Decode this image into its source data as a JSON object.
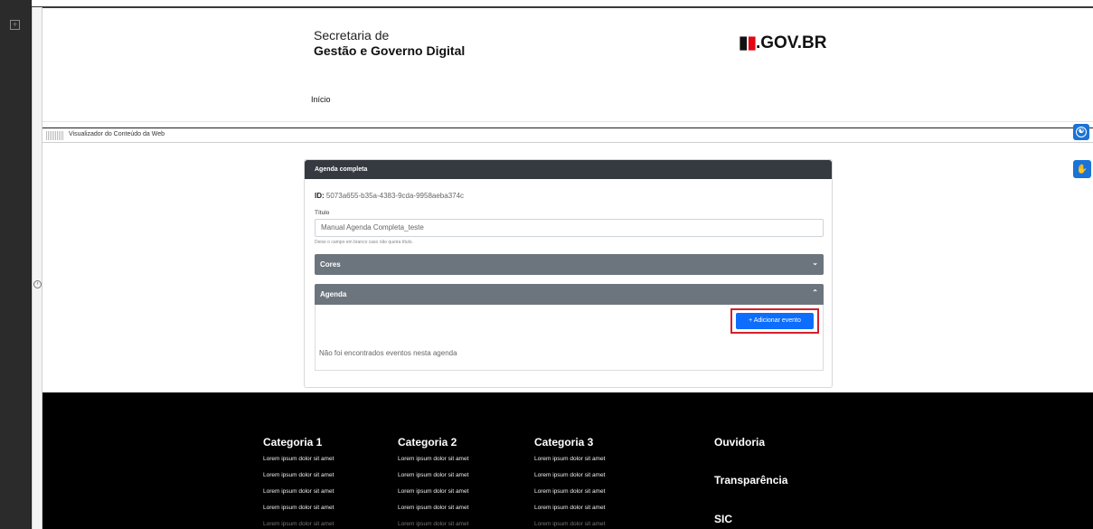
{
  "header": {
    "brand_line1": "Secretaria de",
    "brand_line2": "Gestão e Governo Digital",
    "logo_sp": "SP",
    "logo_text": ".GOV.BR",
    "nav_inicio": "Início"
  },
  "viewer": {
    "label": "Visualizador do Conteúdo da Web"
  },
  "panel": {
    "title": "Agenda completa",
    "id_label": "ID:",
    "id_value": "5073a655-b35a-4383-9cda-9958aeba374c",
    "titulo_label": "Título",
    "titulo_value": "Manual Agenda Completa_teste",
    "hint": "Deixe o campo em branco caso não queira título.",
    "cores_label": "Cores",
    "agenda_label": "Agenda",
    "add_event_label": "+ Adicionar evento",
    "empty_message": "Não foi encontrados eventos nesta agenda"
  },
  "footer": {
    "columns": [
      {
        "title": "Categoria 1",
        "items": [
          "Lorem ipsum dolor sit amet",
          "Lorem ipsum dolor sit amet",
          "Lorem ipsum dolor sit amet",
          "Lorem ipsum dolor sit amet",
          "Lorem ipsum dolor sit amet"
        ]
      },
      {
        "title": "Categoria 2",
        "items": [
          "Lorem ipsum dolor sit amet",
          "Lorem ipsum dolor sit amet",
          "Lorem ipsum dolor sit amet",
          "Lorem ipsum dolor sit amet",
          "Lorem ipsum dolor sit amet"
        ]
      },
      {
        "title": "Categoria 3",
        "items": [
          "Lorem ipsum dolor sit amet",
          "Lorem ipsum dolor sit amet",
          "Lorem ipsum dolor sit amet",
          "Lorem ipsum dolor sit amet",
          "Lorem ipsum dolor sit amet"
        ]
      }
    ],
    "links": [
      "Ouvidoria",
      "Transparência",
      "SIC"
    ]
  },
  "colors": {
    "panel_header": "#343a40",
    "accordion": "#6c757d",
    "primary_button": "#0d6efd",
    "highlight": "#d4202a",
    "logo_red": "#e30613",
    "footer_bg": "#000000",
    "accessibility": "#1a73d6"
  },
  "icons": {
    "add_panel": "plus-box-icon",
    "collapse_rail": "arrow-circle-icon",
    "cores_chevron": "chevron-down-icon",
    "agenda_chevron": "chevron-up-icon",
    "accessibility": "accessibility-icon",
    "libras": "sign-language-icon"
  }
}
